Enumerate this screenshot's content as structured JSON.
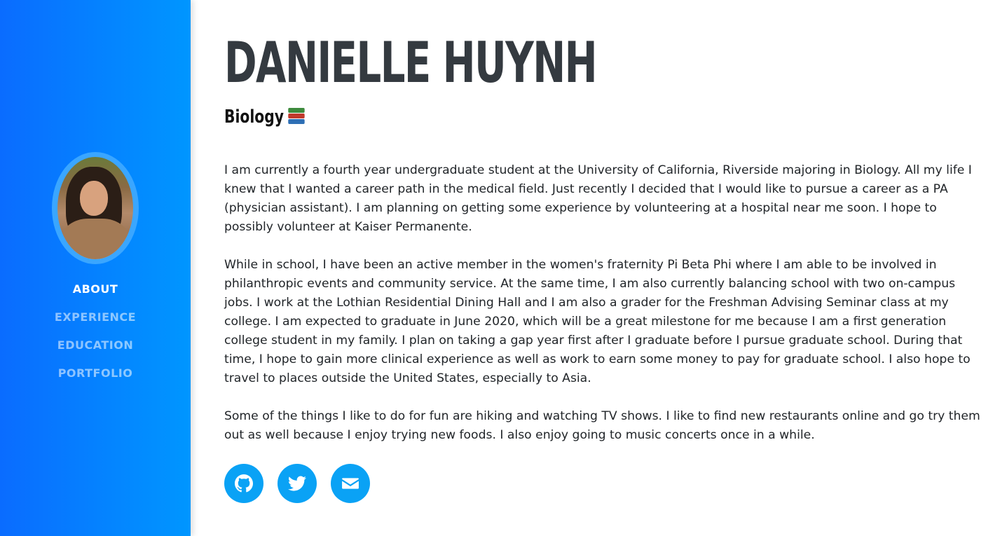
{
  "profile": {
    "name": "DANIELLE HUYNH",
    "subtitle": "Biology",
    "subtitle_icon": "books-icon"
  },
  "nav": {
    "items": [
      {
        "label": "ABOUT",
        "active": true
      },
      {
        "label": "EXPERIENCE",
        "active": false
      },
      {
        "label": "EDUCATION",
        "active": false
      },
      {
        "label": "PORTFOLIO",
        "active": false
      }
    ]
  },
  "about": {
    "paragraphs": [
      "I am currently a fourth year undergraduate student at the University of California, Riverside majoring in Biology. All my life I knew that I wanted a career path in the medical field. Just recently I decided that I would like to pursue a career as a PA (physician assistant). I am planning on getting some experience by volunteering at a hospital near me soon. I hope to possibly volunteer at Kaiser Permanente.",
      "While in school, I have been an active member in the women's fraternity Pi Beta Phi where I am able to be involved in philanthropic events and community service. At the same time, I am also currently balancing school with two on-campus jobs. I work at the Lothian Residential Dining Hall and I am also a grader for the Freshman Advising Seminar class at my college. I am expected to graduate in June 2020, which will be a great milestone for me because I am a first generation college student in my family. I plan on taking a gap year first after I graduate before I pursue graduate school. During that time, I hope to gain more clinical experience as well as work to earn some money to pay for graduate school. I also hope to travel to places outside the United States, especially to Asia.",
      "Some of the things I like to do for fun are hiking and watching TV shows. I like to find new restaurants online and go try them out as well because I enjoy trying new foods. I also enjoy going to music concerts once in a while."
    ]
  },
  "socials": {
    "icons": [
      "github-icon",
      "twitter-icon",
      "envelope-icon"
    ]
  },
  "colors": {
    "sidebar_start": "#0a6cff",
    "sidebar_end": "#0096ff",
    "social_button": "#0aa2f5",
    "heading": "#343a40"
  }
}
